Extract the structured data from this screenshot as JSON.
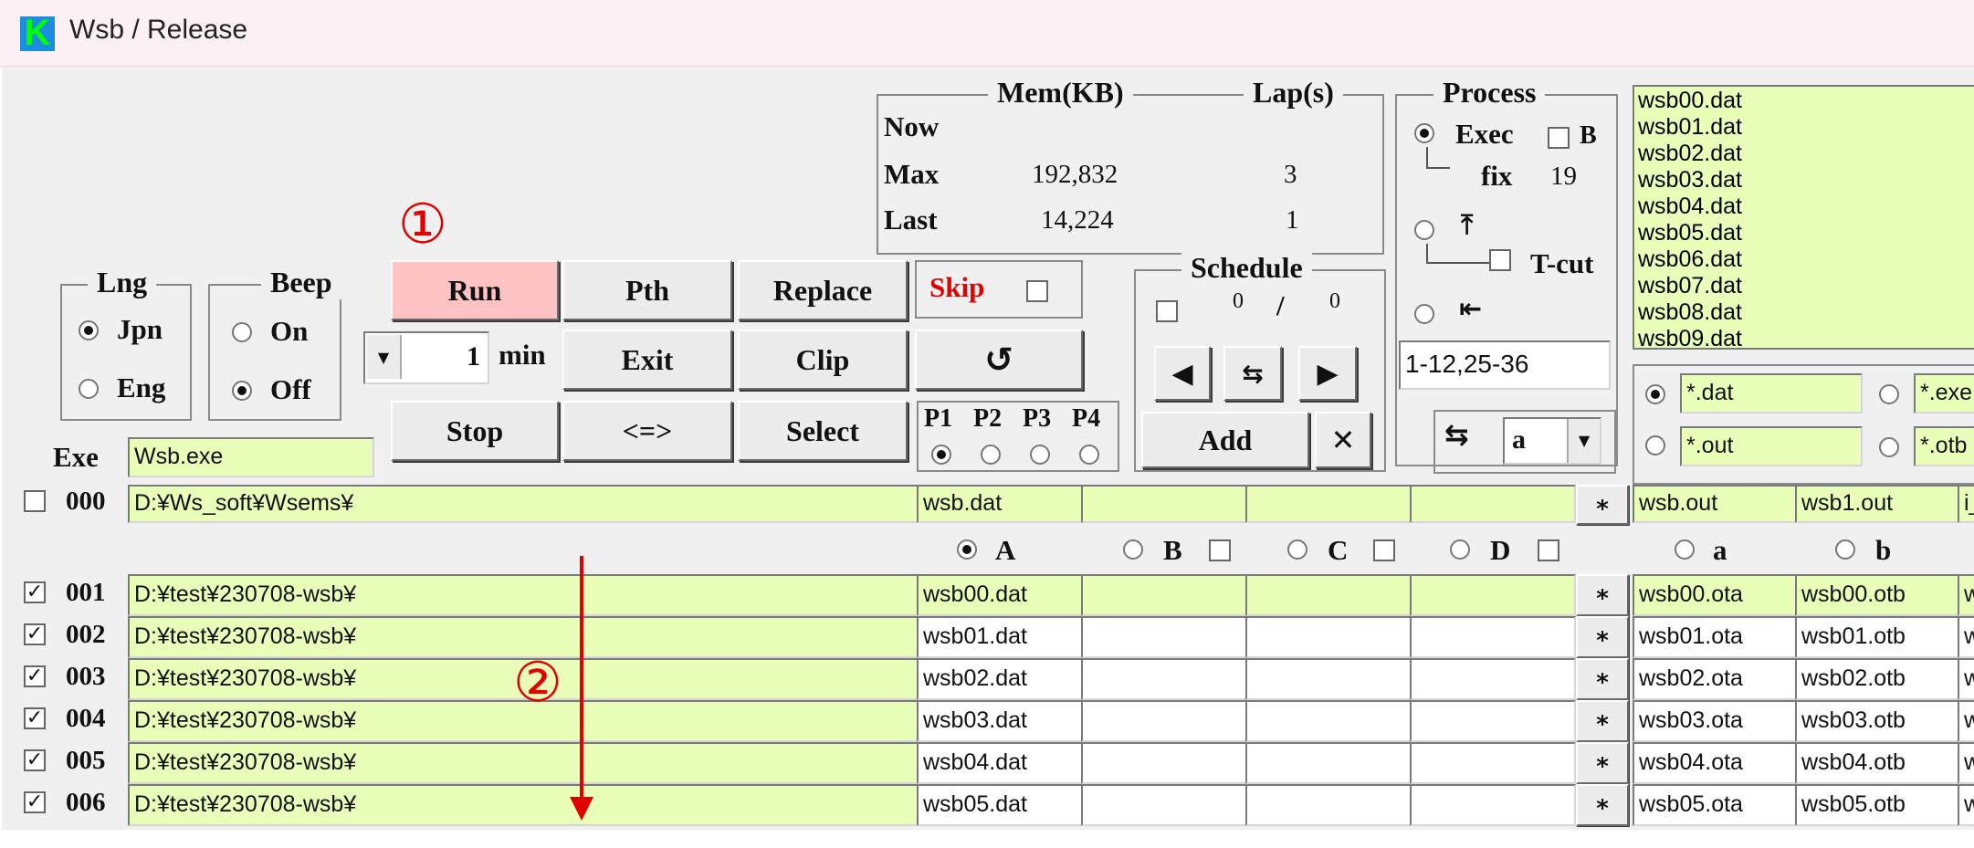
{
  "window": {
    "title": "Wsb / Release",
    "logo_letter": "K"
  },
  "lng": {
    "title": "Lng",
    "opt_jpn": "Jpn",
    "opt_eng": "Eng"
  },
  "beep": {
    "title": "Beep",
    "opt_on": "On",
    "opt_off": "Off"
  },
  "buttons": {
    "run": "Run",
    "pth": "Pth",
    "replace": "Replace",
    "skip": "Skip",
    "min_value": "1",
    "min_unit": "min",
    "exit": "Exit",
    "clip": "Clip",
    "refresh": "↺",
    "stop": "Stop",
    "swap": "<=>",
    "select": "Select",
    "add": "Add",
    "close": "✕",
    "star": "*"
  },
  "mem": {
    "mem_title": "Mem(KB)",
    "lap_title": "Lap(s)",
    "now": "Now",
    "max": "Max",
    "last": "Last",
    "max_mem": "192,832",
    "max_lap": "3",
    "last_mem": "14,224",
    "last_lap": "1"
  },
  "process": {
    "title": "Process",
    "exec": "Exec",
    "b": "B",
    "fix": "fix",
    "fix_value": "19",
    "tcut": "T-cut",
    "range": "1-12,25-36",
    "mode_value": "a"
  },
  "schedule": {
    "title": "Schedule",
    "count_a": "0",
    "slash": "/",
    "count_b": "0"
  },
  "pgroup": {
    "p1": "P1",
    "p2": "P2",
    "p3": "P3",
    "p4": "P4"
  },
  "exe": {
    "label": "Exe",
    "value": "Wsb.exe"
  },
  "filelist": [
    "wsb00.dat",
    "wsb01.dat",
    "wsb02.dat",
    "wsb03.dat",
    "wsb04.dat",
    "wsb05.dat",
    "wsb06.dat",
    "wsb07.dat",
    "wsb08.dat",
    "wsb09.dat"
  ],
  "filters": {
    "dat": "*.dat",
    "exe": "*.exe",
    "out": "*.out",
    "otb": "*.otb"
  },
  "row000": {
    "num": "000",
    "path": "D:¥Ws_soft¥Wsems¥",
    "file": "wsb.dat",
    "out_a": "wsb.out",
    "out_b": "wsb1.out",
    "out_c": "i_"
  },
  "colheads": {
    "a": "A",
    "b": "B",
    "c": "C",
    "d": "D",
    "la": "a",
    "lb": "b"
  },
  "rows": [
    {
      "num": "001",
      "path": "D:¥test¥230708-wsb¥",
      "file": "wsb00.dat",
      "ota": "wsb00.ota",
      "otb": "wsb00.otb",
      "more": "w"
    },
    {
      "num": "002",
      "path": "D:¥test¥230708-wsb¥",
      "file": "wsb01.dat",
      "ota": "wsb01.ota",
      "otb": "wsb01.otb",
      "more": "w"
    },
    {
      "num": "003",
      "path": "D:¥test¥230708-wsb¥",
      "file": "wsb02.dat",
      "ota": "wsb02.ota",
      "otb": "wsb02.otb",
      "more": "w"
    },
    {
      "num": "004",
      "path": "D:¥test¥230708-wsb¥",
      "file": "wsb03.dat",
      "ota": "wsb03.ota",
      "otb": "wsb03.otb",
      "more": "w"
    },
    {
      "num": "005",
      "path": "D:¥test¥230708-wsb¥",
      "file": "wsb04.dat",
      "ota": "wsb04.ota",
      "otb": "wsb04.otb",
      "more": "w"
    },
    {
      "num": "006",
      "path": "D:¥test¥230708-wsb¥",
      "file": "wsb05.dat",
      "ota": "wsb05.ota",
      "otb": "wsb05.otb",
      "more": "w"
    }
  ],
  "annotations": {
    "one": "①",
    "two": "②"
  },
  "colors": {
    "field": "#e9ffb9",
    "run": "#ffc3c3",
    "annotation": "#e00000",
    "skip": "#e00000"
  }
}
